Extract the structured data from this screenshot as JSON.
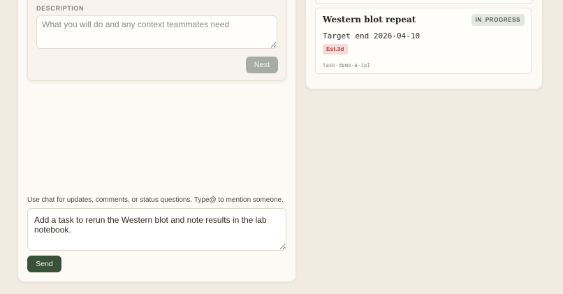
{
  "form": {
    "description_label": "DESCRIPTION",
    "description_placeholder": "What you will do and any context teammates need",
    "description_value": "",
    "next_label": "Next"
  },
  "chat": {
    "hint": "Use chat for updates, comments, or status questions. Type@ to mention someone.",
    "message_value": "Add a task to rerun the Western blot and note results in the lab notebook.",
    "send_label": "Send"
  },
  "task": {
    "title": "Western blot repeat",
    "status": "IN_PROGRESS",
    "target_end": "Target end 2026-04-10",
    "estimate": "Est.3d",
    "id": "task-demo-a-ip1"
  },
  "colors": {
    "background": "#f1ebe2",
    "panel": "#fdfaf6",
    "send_button": "#3a5239",
    "next_button_disabled": "#a7ada1",
    "status_badge_bg": "#e5e8e1",
    "estimate_badge_bg": "#f6dcd8",
    "estimate_badge_text": "#a3463a"
  }
}
